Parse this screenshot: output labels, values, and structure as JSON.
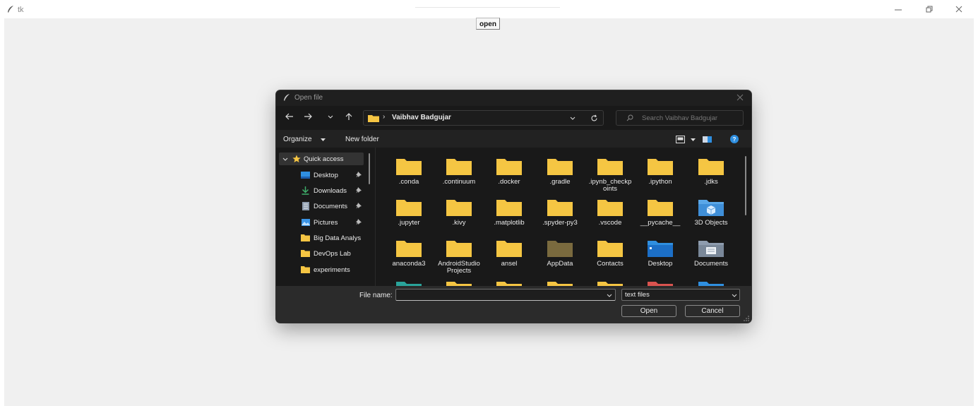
{
  "window": {
    "title": "tk"
  },
  "main": {
    "open_button": "open"
  },
  "dialog": {
    "title": "Open file",
    "address": {
      "separator": "›",
      "path": "Vaibhav Badgujar"
    },
    "search": {
      "placeholder": "Search Vaibhav Badgujar"
    },
    "toolbar": {
      "organize": "Organize",
      "new_folder": "New folder"
    },
    "nav": [
      {
        "label": "Quick access",
        "icon": "star-icon",
        "pinned": false
      },
      {
        "label": "Desktop",
        "icon": "desktop-icon",
        "pinned": true
      },
      {
        "label": "Downloads",
        "icon": "download-icon",
        "pinned": true
      },
      {
        "label": "Documents",
        "icon": "documents-icon",
        "pinned": true
      },
      {
        "label": "Pictures",
        "icon": "pictures-icon",
        "pinned": true
      },
      {
        "label": "Big Data Analys",
        "icon": "folder-icon",
        "pinned": false
      },
      {
        "label": "DevOps Lab",
        "icon": "folder-icon",
        "pinned": false
      },
      {
        "label": "experiments",
        "icon": "folder-icon",
        "pinned": false
      }
    ],
    "files": [
      {
        "name": ".conda",
        "icon": "folder"
      },
      {
        "name": ".continuum",
        "icon": "folder"
      },
      {
        "name": ".docker",
        "icon": "folder"
      },
      {
        "name": ".gradle",
        "icon": "folder"
      },
      {
        "name": ".ipynb_checkpoints",
        "icon": "folder"
      },
      {
        "name": ".ipython",
        "icon": "folder"
      },
      {
        "name": ".jdks",
        "icon": "folder"
      },
      {
        "name": ".jupyter",
        "icon": "folder"
      },
      {
        "name": ".kivy",
        "icon": "folder"
      },
      {
        "name": ".matplotlib",
        "icon": "folder"
      },
      {
        "name": ".spyder-py3",
        "icon": "folder"
      },
      {
        "name": ".vscode",
        "icon": "folder"
      },
      {
        "name": "__pycache__",
        "icon": "folder"
      },
      {
        "name": "3D Objects",
        "icon": "3d-objects"
      },
      {
        "name": "anaconda3",
        "icon": "folder"
      },
      {
        "name": "AndroidStudioProjects",
        "icon": "folder"
      },
      {
        "name": "ansel",
        "icon": "folder"
      },
      {
        "name": "AppData",
        "icon": "folder-hidden"
      },
      {
        "name": "Contacts",
        "icon": "folder"
      },
      {
        "name": "Desktop",
        "icon": "desktop"
      },
      {
        "name": "Documents",
        "icon": "documents"
      }
    ],
    "bottom": {
      "file_name_label": "File name:",
      "file_name_value": "",
      "file_type": "text files",
      "open_button": "Open",
      "cancel_button": "Cancel"
    }
  },
  "colors": {
    "folder": "#f5c543",
    "folder_hidden": "#7a6a3e",
    "accent_blue": "#2f8fe0",
    "dialog_bg": "#191919"
  }
}
